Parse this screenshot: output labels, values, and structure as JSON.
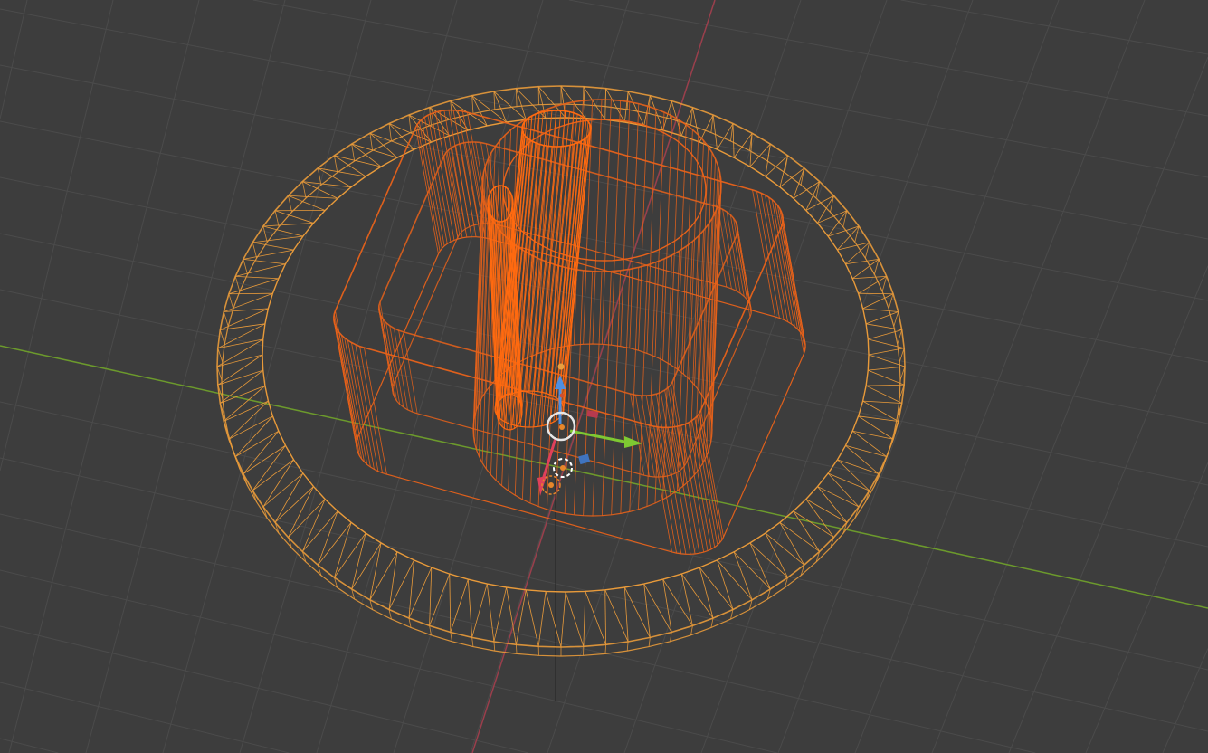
{
  "viewport": {
    "mode": "wireframe",
    "background_color": "#3d3d3d",
    "grid_color": "#4b4b4b",
    "x_axis_color": "#9a3f4c",
    "y_axis_color": "#6c9a2c",
    "wire_color_outer": "#e89a3a",
    "wire_color_inner": "#e8621a"
  },
  "gizmo": {
    "icons": [
      "move-z-arrow-icon",
      "move-y-arrow-icon",
      "move-x-arrow-icon",
      "origin-circle-icon",
      "3d-cursor-icon"
    ],
    "z_color": "#4f8fe0",
    "y_color": "#7ec832",
    "x_color": "#e0405a",
    "plane_xy_color": "#3f74c0",
    "plane_xz_color": "#b83a4e"
  }
}
